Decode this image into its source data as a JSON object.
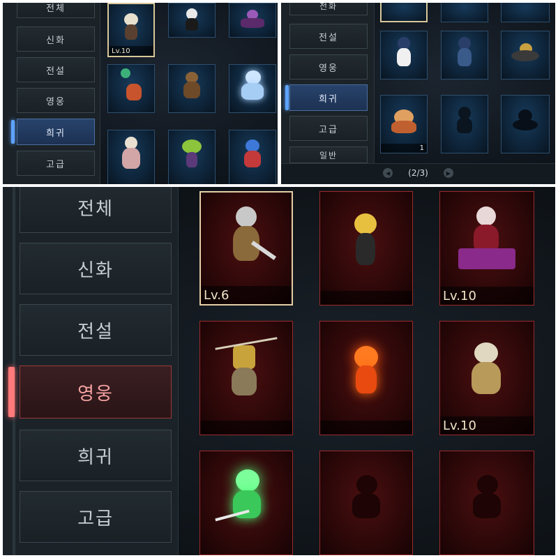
{
  "panel1": {
    "tabs": [
      "전체",
      "신화",
      "전설",
      "영웅",
      "희귀",
      "고급"
    ],
    "active_tab": "희귀",
    "cards": [
      {
        "level": "Lv.10",
        "selected": true,
        "icon": "bunny-ear-pet-icon"
      },
      {
        "level": "",
        "icon": "hooded-ghost-pet-icon"
      },
      {
        "level": "",
        "icon": "horned-winged-demon-pet-icon"
      },
      {
        "level": "",
        "icon": "balloon-fox-pet-icon"
      },
      {
        "level": "",
        "icon": "brown-mole-pet-icon"
      },
      {
        "level": "",
        "icon": "crystal-golem-pet-icon"
      },
      {
        "level": "",
        "icon": "white-yeti-pet-icon"
      },
      {
        "level": "",
        "icon": "green-goblin-pet-icon"
      },
      {
        "level": "",
        "icon": "blue-dragon-pet-icon"
      }
    ]
  },
  "panel2": {
    "tabs": [
      "전체",
      "전설",
      "영웅",
      "희귀",
      "고급",
      "일반"
    ],
    "tab_prefix": "전화",
    "active_tab": "희귀",
    "cards": [
      {
        "level": "",
        "icon": "baseball-boy-pet-icon"
      },
      {
        "level": "",
        "icon": "baseball-catcher-pet-icon"
      },
      {
        "level": "",
        "icon": "mechanical-spider-pet-icon"
      },
      {
        "level": "",
        "count": "1",
        "icon": "spiky-beast-pet-icon"
      },
      {
        "level": "",
        "icon": "locked-silhouette-icon"
      },
      {
        "level": "",
        "icon": "locked-spider-silhouette-icon"
      }
    ],
    "pager": {
      "text": "(2/3)",
      "prev_icon": "prev-arrow-icon",
      "next_icon": "next-arrow-icon"
    }
  },
  "panel3": {
    "tabs": [
      "전체",
      "신화",
      "전설",
      "영웅",
      "희귀",
      "고급"
    ],
    "active_tab": "영웅",
    "cards": [
      {
        "level": "Lv.6",
        "selected": true,
        "icon": "silver-knight-pet-icon"
      },
      {
        "level": "",
        "icon": "blonde-girl-pet-icon"
      },
      {
        "level": "Lv.10",
        "icon": "vampire-coffin-pet-icon"
      },
      {
        "level": "",
        "icon": "mummy-lantern-pet-icon"
      },
      {
        "level": "",
        "icon": "fire-spirit-pet-icon"
      },
      {
        "level": "Lv.10",
        "icon": "golden-armor-pet-icon"
      },
      {
        "level": "",
        "icon": "green-glow-warrior-pet-icon"
      },
      {
        "level": "",
        "icon": "locked-silhouette-icon"
      },
      {
        "level": "",
        "icon": "locked-silhouette-icon"
      }
    ]
  },
  "colors": {
    "active_blue": "#5ea3ff",
    "active_red": "#ff7a7a",
    "level_text": "#f0e6c8",
    "card_blue_bg": "#0d2236",
    "card_red_bg": "#2a0708"
  }
}
